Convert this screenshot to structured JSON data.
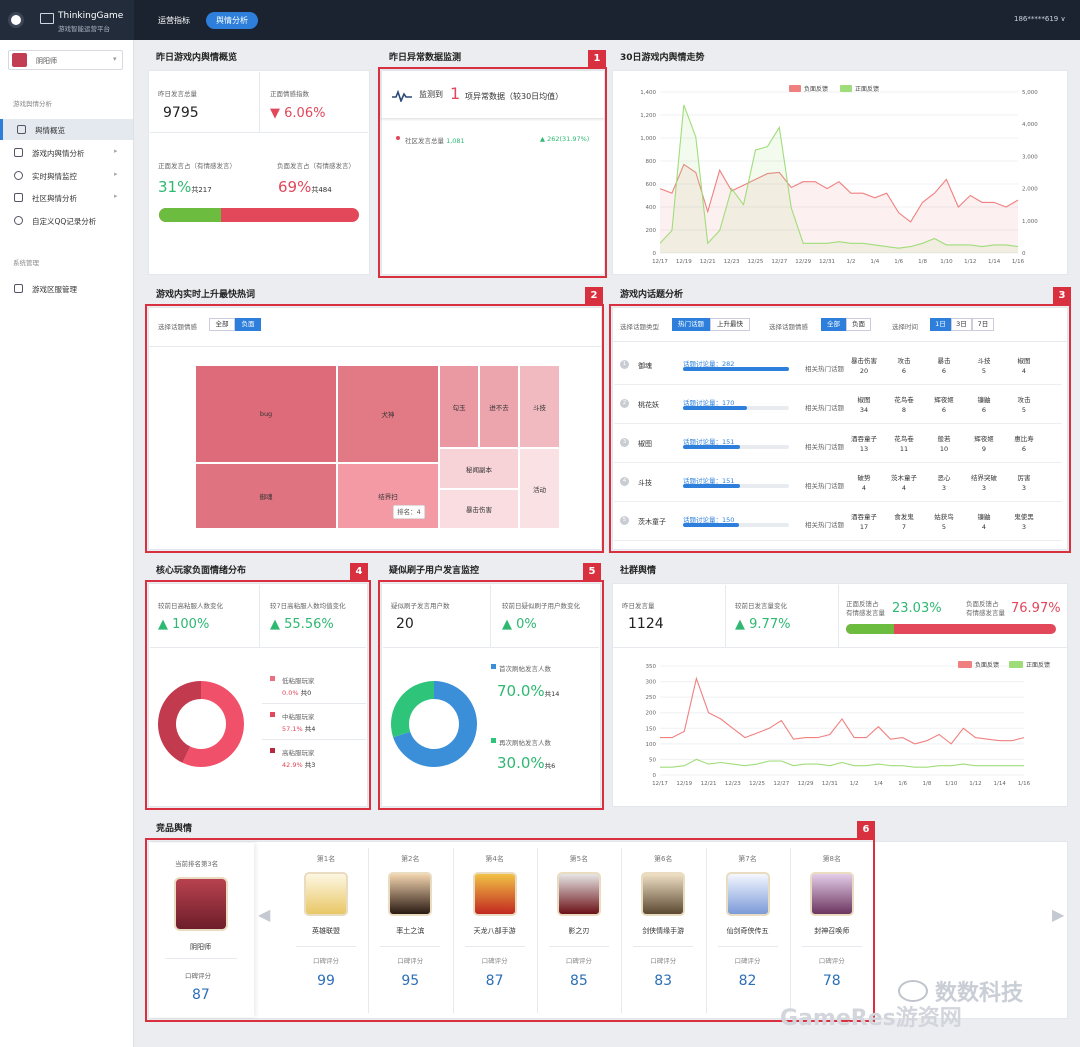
{
  "app": {
    "brand_name": "ThinkingGame",
    "brand_sub": "游戏智能运营平台",
    "user": "186*****619 ∨"
  },
  "nav": {
    "tab1": "运营指标",
    "tab2": "舆情分析"
  },
  "sidebar": {
    "game": "阴阳师",
    "section1": "游戏舆情分析",
    "items": [
      {
        "label": "舆情概览"
      },
      {
        "label": "游戏内舆情分析"
      },
      {
        "label": "实时舆情监控"
      },
      {
        "label": "社区舆情分析"
      },
      {
        "label": "自定义QQ记录分析"
      }
    ],
    "section2": "系统管理",
    "items2": [
      {
        "label": "游戏区服管理"
      }
    ]
  },
  "overview": {
    "title": "昨日游戏内舆情概览",
    "total_label": "昨日发言总量",
    "total": "9795",
    "ratio_label": "正面情感指数",
    "ratio": "6.06%",
    "pos_label": "正面发言占（有情感发言）",
    "pos_pct": "31%",
    "pos_count": "共217",
    "neg_label": "负面发言占（有情感发言）",
    "neg_pct": "69%",
    "neg_count": "共484",
    "pos_share": 0.31
  },
  "anomaly": {
    "title": "昨日异常数据监测",
    "prefix": "监测到",
    "count": "1",
    "suffix": "项异常数据（较30日均值）",
    "item_label": "社区发言总量",
    "item_value": "1,081",
    "item_change": "262(31.97%)"
  },
  "trend": {
    "title": "30日游戏内舆情走势",
    "legend_neg": "负面反馈",
    "legend_pos": "正面反馈"
  },
  "hotwords": {
    "title": "游戏内实时上升最快热词",
    "filter_label": "选择话题情感",
    "btn_all": "全部",
    "btn_neg": "负面",
    "words": [
      "bug",
      "犬神",
      "勾玉",
      "进不去",
      "斗技",
      "御魂",
      "结界扫",
      "秘闻副本",
      "活动",
      "暴击伤害"
    ],
    "tooltip": "排名：4"
  },
  "topics": {
    "title": "游戏内话题分析",
    "type_label": "选择话题类型",
    "type_hot": "热门话题",
    "type_rise": "上升最快",
    "emo_label": "选择话题情感",
    "emo_all": "全部",
    "emo_neg": "负面",
    "time_label": "选择时间",
    "t1": "1日",
    "t2": "3日",
    "t3": "7日",
    "related": "相关热门话题",
    "rows": [
      {
        "name": "御魂",
        "count": "话题讨论量：282",
        "share": 1.0,
        "tags": [
          [
            "暴击伤害",
            "20"
          ],
          [
            "攻击",
            "6"
          ],
          [
            "暴击",
            "6"
          ],
          [
            "斗技",
            "5"
          ],
          [
            "椒图",
            "4"
          ]
        ]
      },
      {
        "name": "桃花妖",
        "count": "话题讨论量：170",
        "share": 0.6,
        "tags": [
          [
            "椒图",
            "34"
          ],
          [
            "花鸟卷",
            "8"
          ],
          [
            "辉夜姬",
            "6"
          ],
          [
            "镰鼬",
            "6"
          ],
          [
            "攻击",
            "5"
          ]
        ]
      },
      {
        "name": "椒图",
        "count": "话题讨论量：151",
        "share": 0.54,
        "tags": [
          [
            "酒吞童子",
            "13"
          ],
          [
            "花鸟卷",
            "11"
          ],
          [
            "般若",
            "10"
          ],
          [
            "辉夜姬",
            "9"
          ],
          [
            "惠比寿",
            "6"
          ]
        ]
      },
      {
        "name": "斗技",
        "count": "话题讨论量：151",
        "share": 0.54,
        "tags": [
          [
            "破势",
            "4"
          ],
          [
            "茨木童子",
            "4"
          ],
          [
            "恶心",
            "3"
          ],
          [
            "结界突破",
            "3"
          ],
          [
            "厉害",
            "3"
          ]
        ]
      },
      {
        "name": "茨木童子",
        "count": "话题讨论量：150",
        "share": 0.53,
        "tags": [
          [
            "酒吞童子",
            "17"
          ],
          [
            "食发鬼",
            "7"
          ],
          [
            "姑获鸟",
            "5"
          ],
          [
            "镰鼬",
            "4"
          ],
          [
            "鬼使黑",
            "3"
          ]
        ]
      }
    ]
  },
  "core": {
    "title": "核心玩家负面情绪分布",
    "l1": "较前日高粘服人数变化",
    "v1": "100%",
    "l2": "较7日高粘服人数均值变化",
    "v2": "55.56%",
    "legend": [
      {
        "name": "低粘服玩家",
        "pct": "0.0%",
        "count": "共0",
        "color": "#e9707f"
      },
      {
        "name": "中粘服玩家",
        "pct": "57.1%",
        "count": "共4",
        "color": "#e2475a"
      },
      {
        "name": "高粘服玩家",
        "pct": "42.9%",
        "count": "共3",
        "color": "#b52a3d"
      }
    ]
  },
  "bots": {
    "title": "疑似刷子用户发言监控",
    "l1": "疑似刷子发言用户数",
    "v1": "20",
    "l2": "较前日疑似刷子用户数变化",
    "v2": "0%",
    "first_label": "首次刷帖发言人数",
    "first_pct": "70.0%",
    "first_count": "共14",
    "again_label": "再次刷帖发言人数",
    "again_pct": "30.0%",
    "again_count": "共6"
  },
  "community": {
    "title": "社群舆情",
    "l1": "昨日发言量",
    "v1": "1124",
    "l2": "较前日发言量变化",
    "v2": "9.77%",
    "pos_l": "正面反馈占",
    "pos_l2": "有情感发言量",
    "pos_v": "23.03%",
    "neg_l": "负面反馈占",
    "neg_l2": "有情感发言量",
    "neg_v": "76.97%",
    "pos_share": 0.2303,
    "legend_neg": "负面反馈",
    "legend_pos": "正面反馈"
  },
  "competitors": {
    "title": "竞品舆情",
    "current_rank": "当前排名第3名",
    "current_name": "阴阳师",
    "score_label": "口碑评分",
    "current_score": "87",
    "items": [
      {
        "rank": "第1名",
        "name": "英雄联盟",
        "score": "99"
      },
      {
        "rank": "第2名",
        "name": "率土之滨",
        "score": "95"
      },
      {
        "rank": "第4名",
        "name": "天龙八部手游",
        "score": "87"
      },
      {
        "rank": "第5名",
        "name": "影之刃",
        "score": "85"
      },
      {
        "rank": "第6名",
        "name": "剑侠情缘手游",
        "score": "83"
      },
      {
        "rank": "第7名",
        "name": "仙剑奇侠传五",
        "score": "82"
      },
      {
        "rank": "第8名",
        "name": "封神召唤师",
        "score": "78"
      }
    ]
  },
  "annotations": {
    "b1": "1",
    "b2": "2",
    "b3": "3",
    "b4": "4",
    "b5": "5",
    "b6": "6"
  },
  "watermark": {
    "wechat": "数数科技",
    "site": "GameRes游资网"
  },
  "chart_data": [
    {
      "type": "line",
      "title": "30日游戏内舆情走势",
      "x": [
        "12/17",
        "12/18",
        "12/19",
        "12/20",
        "12/21",
        "12/22",
        "12/23",
        "12/24",
        "12/25",
        "12/26",
        "12/27",
        "12/28",
        "12/29",
        "12/30",
        "12/31",
        "1/1",
        "1/2",
        "1/3",
        "1/4",
        "1/5",
        "1/6",
        "1/7",
        "1/8",
        "1/9",
        "1/10",
        "1/11",
        "1/12",
        "1/13",
        "1/14",
        "1/15",
        "1/16"
      ],
      "xticks": [
        "12/17",
        "12/19",
        "12/21",
        "12/23",
        "12/25",
        "12/27",
        "12/29",
        "12/31",
        "1/2",
        "1/4",
        "1/6",
        "1/8",
        "1/10",
        "1/12",
        "1/14",
        "1/16"
      ],
      "series": [
        {
          "name": "负面反馈",
          "axis": "left",
          "color": "#f08080",
          "values": [
            560,
            520,
            770,
            700,
            360,
            720,
            540,
            590,
            640,
            690,
            700,
            570,
            620,
            620,
            560,
            620,
            520,
            520,
            480,
            520,
            350,
            270,
            440,
            520,
            640,
            400,
            500,
            440,
            440,
            400,
            460
          ]
        },
        {
          "name": "正面反馈",
          "axis": "right",
          "color": "#9fdd7a",
          "values": [
            300,
            700,
            4600,
            3600,
            300,
            700,
            2000,
            1500,
            3200,
            3300,
            3900,
            1400,
            300,
            300,
            300,
            350,
            300,
            300,
            250,
            200,
            150,
            200,
            300,
            450,
            250,
            250,
            250,
            200,
            250,
            250,
            200
          ]
        }
      ],
      "ylim_left": [
        0,
        1400
      ],
      "yticks_left": [
        0,
        200,
        400,
        600,
        800,
        1000,
        1200,
        1400
      ],
      "ylim_right": [
        0,
        5000
      ],
      "yticks_right": [
        0,
        1000,
        2000,
        3000,
        4000,
        5000
      ],
      "legend": "top"
    },
    {
      "type": "treemap",
      "title": "游戏内实时上升最快热词",
      "items": [
        "bug",
        "犬神",
        "勾玉",
        "进不去",
        "斗技",
        "御魂",
        "结界扫",
        "秘闻副本",
        "活动",
        "暴击伤害"
      ]
    },
    {
      "type": "pie",
      "title": "核心玩家负面情绪分布",
      "labels": [
        "低粘服玩家",
        "中粘服玩家",
        "高粘服玩家"
      ],
      "values": [
        0.0,
        57.1,
        42.9
      ]
    },
    {
      "type": "pie",
      "title": "疑似刷子用户发言监控",
      "labels": [
        "首次刷帖发言人数",
        "再次刷帖发言人数"
      ],
      "values": [
        70.0,
        30.0
      ]
    },
    {
      "type": "line",
      "title": "社群舆情",
      "x": [
        "12/17",
        "12/18",
        "12/19",
        "12/20",
        "12/21",
        "12/22",
        "12/23",
        "12/24",
        "12/25",
        "12/26",
        "12/27",
        "12/28",
        "12/29",
        "12/30",
        "12/31",
        "1/1",
        "1/2",
        "1/3",
        "1/4",
        "1/5",
        "1/6",
        "1/7",
        "1/8",
        "1/9",
        "1/10",
        "1/11",
        "1/12",
        "1/13",
        "1/14",
        "1/15",
        "1/16"
      ],
      "xticks": [
        "12/17",
        "12/19",
        "12/21",
        "12/23",
        "12/25",
        "12/27",
        "12/29",
        "12/31",
        "1/2",
        "1/4",
        "1/6",
        "1/8",
        "1/10",
        "1/12",
        "1/14",
        "1/16"
      ],
      "series": [
        {
          "name": "负面反馈",
          "color": "#f08080",
          "values": [
            120,
            120,
            140,
            310,
            200,
            180,
            150,
            120,
            135,
            150,
            175,
            115,
            120,
            120,
            130,
            180,
            120,
            120,
            155,
            115,
            120,
            100,
            110,
            130,
            100,
            150,
            120,
            115,
            110,
            110,
            120
          ]
        },
        {
          "name": "正面反馈",
          "color": "#9fdd7a",
          "values": [
            25,
            25,
            30,
            50,
            35,
            40,
            35,
            30,
            35,
            45,
            45,
            30,
            35,
            35,
            30,
            40,
            30,
            30,
            35,
            30,
            30,
            25,
            25,
            30,
            30,
            35,
            30,
            30,
            30,
            30,
            30
          ]
        }
      ],
      "ylim": [
        0,
        350
      ],
      "yticks": [
        0,
        50,
        100,
        150,
        200,
        250,
        300,
        350
      ],
      "legend": "top-right"
    }
  ]
}
